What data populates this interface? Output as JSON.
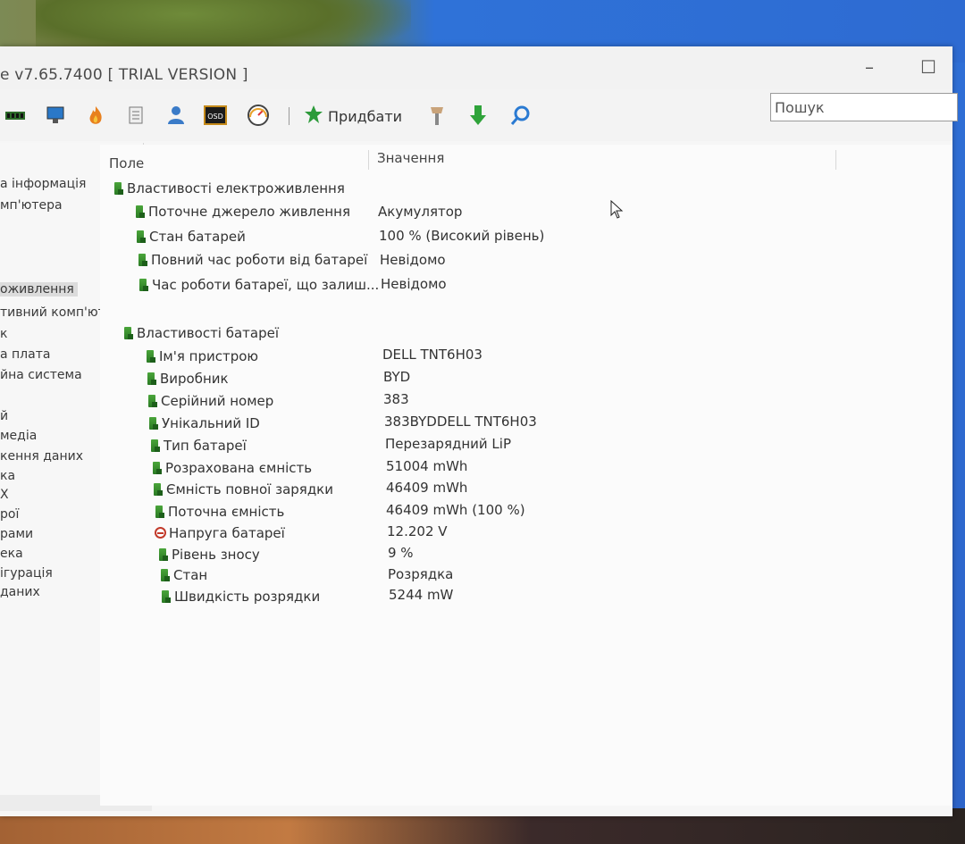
{
  "window": {
    "title": "e v7.65.7400  [ TRIAL VERSION ]"
  },
  "toolbar": {
    "add_label": "Придбати",
    "search_placeholder": "Пошук",
    "icons": [
      "memory-icon",
      "monitor-icon",
      "flame-icon",
      "files-icon",
      "user-icon",
      "osd-icon",
      "gauge-icon",
      "add-icon",
      "wrench-icon",
      "download-icon",
      "search-icon"
    ]
  },
  "sidebar": {
    "items": [
      "а інформація",
      "мп'ютера",
      "оживлення",
      "тивний комп'юте",
      "к",
      "а плата",
      "йна система",
      "й",
      "медіа",
      "кення даних",
      "ка",
      "Х",
      "рої",
      "рами",
      "ека",
      "ігурація",
      " даних"
    ],
    "selected_index": 2
  },
  "table": {
    "col_field": "Поле",
    "col_value": "Значення",
    "rows": [
      {
        "label": "Властивості електроживлення",
        "value": "",
        "icon": "battery-icon"
      },
      {
        "label": "Поточне джерело живлення",
        "value": "Акумулятор",
        "icon": "battery-icon"
      },
      {
        "label": "Стан батарей",
        "value": "100 % (Високий рівень)",
        "icon": "battery-icon"
      },
      {
        "label": "Повний час роботи від батареї",
        "value": "Невідомо",
        "icon": "battery-icon"
      },
      {
        "label": "Час роботи батареї, що залиш...",
        "value": "Невідомо",
        "icon": "battery-icon"
      },
      {
        "label": "Властивості батареї",
        "value": "",
        "icon": "battery-icon"
      },
      {
        "label": "Ім'я пристрою",
        "value": "DELL TNT6H03",
        "icon": "battery-icon"
      },
      {
        "label": "Виробник",
        "value": "BYD",
        "icon": "battery-icon"
      },
      {
        "label": "Серійний номер",
        "value": "383",
        "icon": "battery-icon"
      },
      {
        "label": "Унікальний ID",
        "value": "383BYDDELL TNT6H03",
        "icon": "battery-icon"
      },
      {
        "label": "Тип батареї",
        "value": "Перезарядний LiP",
        "icon": "battery-icon"
      },
      {
        "label": "Розрахована ємність",
        "value": "51004 mWh",
        "icon": "battery-icon"
      },
      {
        "label": "Ємність повної зарядки",
        "value": "46409 mWh",
        "icon": "battery-icon"
      },
      {
        "label": "Поточна ємність",
        "value": "46409 mWh  (100 %)",
        "icon": "battery-icon"
      },
      {
        "label": "Напруга батареї",
        "value": "12.202 V",
        "icon": "voltage-icon"
      },
      {
        "label": "Рівень зносу",
        "value": "9 %",
        "icon": "battery-icon"
      },
      {
        "label": "Стан",
        "value": "Розрядка",
        "icon": "battery-icon"
      },
      {
        "label": "Швидкість розрядки",
        "value": "5244 mW",
        "icon": "battery-icon"
      }
    ]
  }
}
